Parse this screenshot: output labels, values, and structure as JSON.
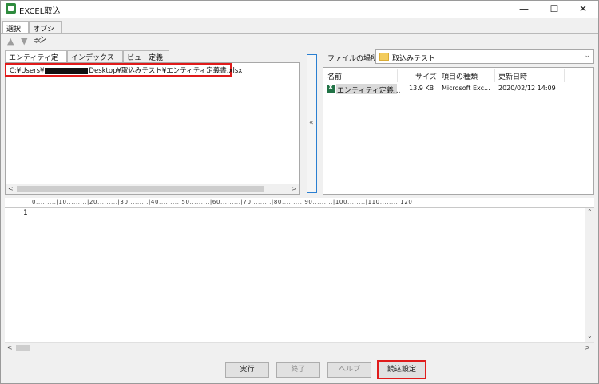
{
  "window": {
    "title": "EXCEL取込",
    "minimize": "—",
    "maximize": "☐",
    "close": "✕"
  },
  "main_tabs": [
    {
      "label": "選択"
    },
    {
      "label": "オプション"
    }
  ],
  "toolbar": {
    "up_glyph": "▲",
    "down_glyph": "▼",
    "delete_glyph": "✕"
  },
  "sub_tabs": [
    {
      "label": "エンティティ定義書"
    },
    {
      "label": "インデックス一覧"
    },
    {
      "label": "ビュー定義書"
    }
  ],
  "path": {
    "prefix": "C:¥Users¥",
    "suffix": "Desktop¥取込みテスト¥エンティティ定義書.xlsx"
  },
  "splitter_glyph": "«",
  "file_location": {
    "label": "ファイルの場所",
    "value": "取込みテスト"
  },
  "file_list": {
    "columns": [
      "名前",
      "サイズ",
      "項目の種類",
      "更新日時"
    ],
    "rows": [
      {
        "name": "エンティティ定義...",
        "size": "13.9 KB",
        "type": "Microsoft Exc...",
        "modified": "2020/02/12 14:09"
      }
    ]
  },
  "ruler": {
    "text": "0,,,,,,,,,|10,,,,,,,,,|20,,,,,,,,,|30,,,,,,,,,|40,,,,,,,,,|50,,,,,,,,,|60,,,,,,,,,|70,,,,,,,,,|80,,,,,,,,,|90,,,,,,,,,|100,,,,,,,,|110,,,,,,,,|120"
  },
  "editor": {
    "line_number": "1"
  },
  "buttons": {
    "run": "実行",
    "exit": "終了",
    "help": "ヘルプ",
    "load_settings": "読込設定"
  }
}
